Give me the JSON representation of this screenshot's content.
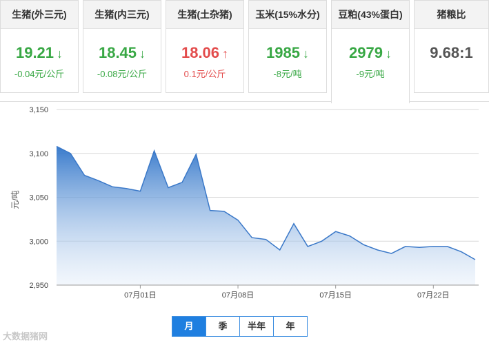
{
  "cards": [
    {
      "title": "生猪(外三元)",
      "value": "19.21",
      "change": "-0.04元/公斤",
      "direction": "down"
    },
    {
      "title": "生猪(内三元)",
      "value": "18.45",
      "change": "-0.08元/公斤",
      "direction": "down"
    },
    {
      "title": "生猪(土杂猪)",
      "value": "18.06",
      "change": "0.1元/公斤",
      "direction": "up"
    },
    {
      "title": "玉米(15%水分)",
      "value": "1985",
      "change": "-8元/吨",
      "direction": "down"
    },
    {
      "title": "豆粕(43%蛋白)",
      "value": "2979",
      "change": "-9元/吨",
      "direction": "down"
    },
    {
      "title": "猪粮比",
      "value": "9.68:1",
      "change": "",
      "direction": "none"
    }
  ],
  "active_card": 4,
  "colors": {
    "down": "#39a845",
    "up": "#e34c4c",
    "accent": "#1f7fe0",
    "line": "#3a78c8"
  },
  "icons": {
    "down": "arrow-down-icon",
    "up": "arrow-up-icon"
  },
  "tabs": [
    "月",
    "季",
    "半年",
    "年"
  ],
  "active_tab": 0,
  "watermark": "大数据猪网",
  "chart_data": {
    "type": "area",
    "title": "",
    "xlabel": "",
    "ylabel": "元/吨",
    "ylim": [
      2950,
      3150
    ],
    "yticks": [
      "2,950",
      "3,000",
      "3,050",
      "3,100",
      "3,150"
    ],
    "ytick_values": [
      2950,
      3000,
      3050,
      3100,
      3150
    ],
    "xticks": [
      "07月01日",
      "07月08日",
      "07月15日",
      "07月22日"
    ],
    "xtick_days": [
      1,
      8,
      15,
      22
    ],
    "grid": "horizontal",
    "series": [
      {
        "x_days": [
          -5,
          -4,
          -3,
          -2,
          -1,
          0,
          1,
          2,
          3,
          4,
          5,
          6,
          7,
          8,
          9,
          10,
          11,
          12,
          13,
          14,
          15,
          16,
          17,
          18,
          19,
          20,
          21,
          22,
          23,
          24,
          25
        ],
        "values": [
          3108,
          3100,
          3075,
          3069,
          3062,
          3060,
          3057,
          3103,
          3061,
          3067,
          3099,
          3035,
          3034,
          3024,
          3004,
          3002,
          2990,
          3020,
          2994,
          3000,
          3011,
          3006,
          2996,
          2990,
          2986,
          2994,
          2993,
          2994,
          2994,
          2988,
          2979
        ]
      }
    ]
  }
}
